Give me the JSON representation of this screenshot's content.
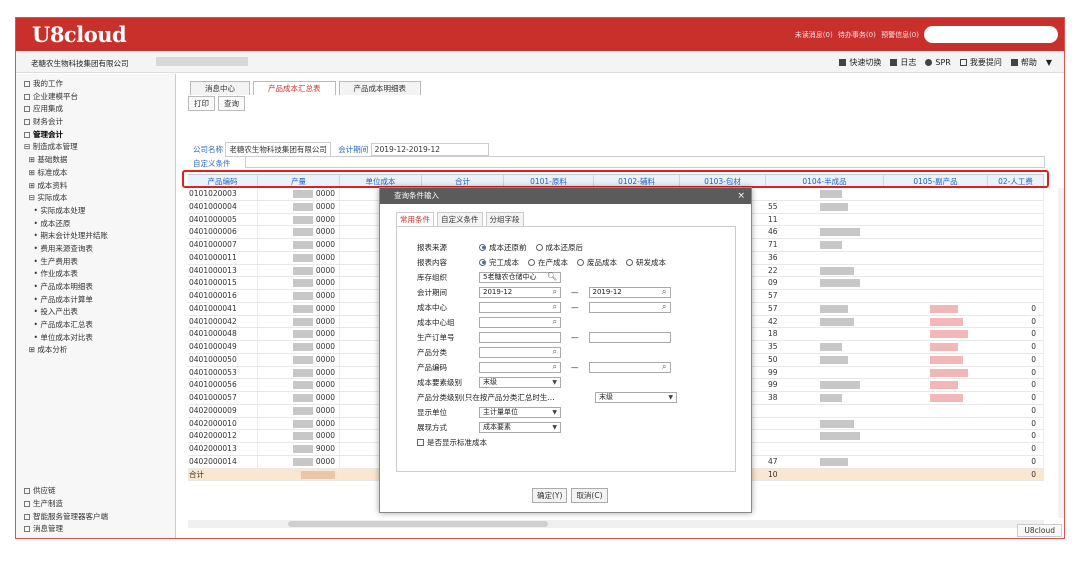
{
  "app": {
    "logo": "U8cloud",
    "notices": [
      "未读消息(0)",
      "待办事务(0)",
      "预警信息(0)"
    ],
    "company": "老糖农生物科技集团有限公司",
    "toolbar": [
      "快速切换",
      "日志",
      "SPR",
      "我要提问",
      "帮助"
    ],
    "footer_brand": "U8cloud"
  },
  "sidebar": {
    "items": [
      {
        "label": "我的工作",
        "icon": "gear-icon"
      },
      {
        "label": "企业建模平台",
        "icon": "grid-icon"
      },
      {
        "label": "应用集成",
        "icon": "grid-icon"
      },
      {
        "label": "财务会计",
        "icon": "grid-icon"
      },
      {
        "label": "管理会计",
        "icon": "grid-icon",
        "active": true
      },
      {
        "label": "⊟ 制造成本管理"
      },
      {
        "label": "  ⊞ 基础数据"
      },
      {
        "label": "  ⊞ 标准成本"
      },
      {
        "label": "  ⊞ 成本资料"
      },
      {
        "label": "  ⊟ 实际成本"
      },
      {
        "label": "    • 实际成本处理"
      },
      {
        "label": "    • 成本还原"
      },
      {
        "label": "    • 期末会计处理并结账"
      },
      {
        "label": "    • 费用来源查询表"
      },
      {
        "label": "    • 生产费用表"
      },
      {
        "label": "    • 作业成本表"
      },
      {
        "label": "    • 产品成本明细表"
      },
      {
        "label": "    • 产品成本计算单"
      },
      {
        "label": "    • 投入产出表"
      },
      {
        "label": "    • 产品成本汇总表"
      },
      {
        "label": "    • 单位成本对比表"
      },
      {
        "label": "  ⊞ 成本分析"
      }
    ],
    "bottom_items": [
      "供应链",
      "生产制造",
      "智能服务管理器客户端",
      "消息管理"
    ]
  },
  "tabs": [
    {
      "label": "消息中心",
      "active": false
    },
    {
      "label": "产品成本汇总表",
      "active": true
    },
    {
      "label": "产品成本明细表",
      "active": false
    }
  ],
  "buttons": {
    "print": "打印",
    "query": "查询"
  },
  "filters": {
    "company_label": "公司名称",
    "company_value": "老糖农生物科技集团有限公司",
    "period_label": "会计期间",
    "period_value": "2019-12-2019-12",
    "custom_label": "自定义条件"
  },
  "table": {
    "columns": [
      "产品编码",
      "产量",
      "单位成本",
      "合计",
      "0101-原料",
      "0102-辅料",
      "0103-包材",
      "0104-半成品",
      "0105-副产品",
      "02-人工费"
    ],
    "rows": [
      {
        "code": "0101020003",
        "qty": "0000",
        "tail": "",
        "zero": ""
      },
      {
        "code": "0401000004",
        "qty": "0000",
        "tail": "55",
        "zero": ""
      },
      {
        "code": "0401000005",
        "qty": "0000",
        "tail": "11",
        "zero": ""
      },
      {
        "code": "0401000006",
        "qty": "0000",
        "tail": "46",
        "zero": ""
      },
      {
        "code": "0401000007",
        "qty": "0000",
        "tail": "71",
        "zero": ""
      },
      {
        "code": "0401000011",
        "qty": "0000",
        "tail": "36",
        "zero": ""
      },
      {
        "code": "0401000013",
        "qty": "0000",
        "tail": "22",
        "zero": ""
      },
      {
        "code": "0401000015",
        "qty": "0000",
        "tail": "09",
        "zero": ""
      },
      {
        "code": "0401000016",
        "qty": "0000",
        "tail": "57",
        "zero": ""
      },
      {
        "code": "0401000041",
        "qty": "0000",
        "tail": "57",
        "zero": "0"
      },
      {
        "code": "0401000042",
        "qty": "0000",
        "tail": "42",
        "zero": "0"
      },
      {
        "code": "0401000048",
        "qty": "0000",
        "tail": "18",
        "zero": "0"
      },
      {
        "code": "0401000049",
        "qty": "0000",
        "tail": "35",
        "zero": "0"
      },
      {
        "code": "0401000050",
        "qty": "0000",
        "tail": "50",
        "zero": "0"
      },
      {
        "code": "0401000053",
        "qty": "0000",
        "tail": "99",
        "zero": "0"
      },
      {
        "code": "0401000056",
        "qty": "0000",
        "tail": "99",
        "zero": "0"
      },
      {
        "code": "0401000057",
        "qty": "0000",
        "tail": "38",
        "zero": "0"
      },
      {
        "code": "0402000009",
        "qty": "0000",
        "tail": "",
        "zero": "0"
      },
      {
        "code": "0402000010",
        "qty": "0000",
        "tail": "",
        "zero": "0"
      },
      {
        "code": "0402000012",
        "qty": "0000",
        "tail": "",
        "zero": "0"
      },
      {
        "code": "0402000013",
        "qty": "9000",
        "tail": "",
        "zero": "0"
      },
      {
        "code": "0402000014",
        "qty": "0000",
        "tail": "47",
        "zero": "0"
      }
    ],
    "total_label": "合计",
    "total_tail": "10",
    "total_zero": "0"
  },
  "dialog": {
    "title": "查询条件输入",
    "close": "×",
    "tabs": [
      "常用条件",
      "自定义条件",
      "分组字段"
    ],
    "source_label": "报表来源",
    "source_options": [
      "成本还原前",
      "成本还原后"
    ],
    "content_label": "报表内容",
    "content_options": [
      "完工成本",
      "在产成本",
      "废品成本",
      "研发成本"
    ],
    "warehouse_label": "库存组织",
    "warehouse_value": "5老糖农仓储中心",
    "period_label": "会计期间",
    "period_from": "2019-12",
    "period_to": "2019-12",
    "dash": "—",
    "cost_center_label": "成本中心",
    "cost_center_group_label": "成本中心组",
    "order_label": "生产订单号",
    "category_label": "产品分类",
    "product_code_label": "产品编码",
    "element_level_label": "成本要素级别",
    "element_level_value": "末级",
    "cat_level_label": "产品分类级别(只在按产品分类汇总时生...",
    "cat_level_value": "末级",
    "unit_label": "显示单位",
    "unit_value": "主计量单位",
    "display_label": "展现方式",
    "display_value": "成本要素",
    "std_cost_label": "是否显示标准成本",
    "ok": "确定(Y)",
    "cancel": "取消(C)"
  },
  "colors": {
    "brand": "#c9302c",
    "header_text": "#1f63c4",
    "highlight": "#e02020"
  }
}
